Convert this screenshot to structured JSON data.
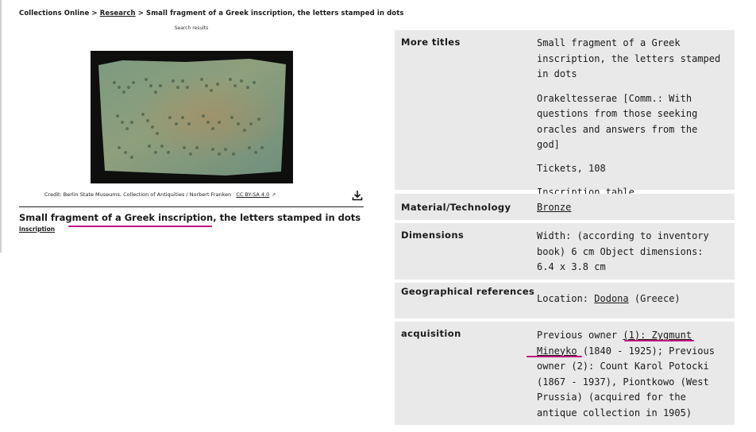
{
  "breadcrumb": {
    "root": "Collections Online",
    "sep": ">",
    "research": "Research",
    "current": "Small fragment of a Greek inscription, the letters stamped in dots"
  },
  "search_results": "Search results",
  "image": {
    "credit": "Credit: Berlin State Museums, Collection of Antiquities / Norbert Franken",
    "license": "CC BY-SA 4.0",
    "icons": [
      "external-link-icon",
      "download-icon"
    ]
  },
  "object": {
    "title": "Small fragment of a Greek inscription, the letters stamped in dots",
    "type": "inscription"
  },
  "details": {
    "more_titles": {
      "label": "More titles",
      "values": [
        "Small fragment of a Greek inscription, the letters stamped in dots",
        "Orakeltesserae [Comm.: With questions from those seeking oracles and answers from the god]",
        "Tickets, 108",
        "Inscription table"
      ]
    },
    "material": {
      "label": "Material/Technology",
      "value": "Bronze"
    },
    "dimensions": {
      "label": "Dimensions",
      "value": "Width: (according to inventory book) 6 cm Object dimensions: 6.4 x 3.8 cm"
    },
    "geo": {
      "label": "Geographical references",
      "prefix": "Location:",
      "place": "Dodona",
      "suffix": "(Greece)"
    },
    "acquisition": {
      "label": "acquisition",
      "prefix": "Previous owner",
      "owner_link": "(1): Zygmunt Mineyko",
      "rest": "(1840 - 1925); Previous owner (2): Count Karol Potocki (1867 - 1937), Piontkowo (West Prussia) (acquired for the antique collection in 1905)"
    }
  },
  "colors": {
    "row_bg": "#e9e9e9",
    "highlight": "#c0157d"
  }
}
